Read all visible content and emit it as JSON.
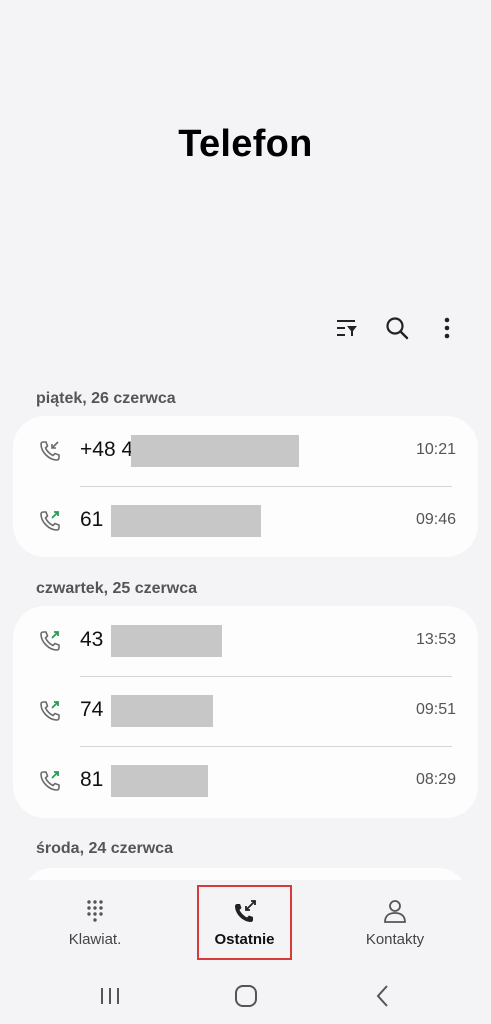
{
  "header": {
    "title": "Telefon"
  },
  "toolbar": {
    "filter_icon": "filter-icon",
    "search_icon": "search-icon",
    "more_icon": "more-vertical-icon"
  },
  "groups": [
    {
      "date": "piątek, 26 czerwca",
      "calls": [
        {
          "number": "+48 4",
          "time": "10:21",
          "type": "incoming"
        },
        {
          "number": "61",
          "time": "09:46",
          "type": "outgoing"
        }
      ]
    },
    {
      "date": "czwartek, 25 czerwca",
      "calls": [
        {
          "number": "43",
          "time": "13:53",
          "type": "outgoing"
        },
        {
          "number": "74",
          "time": "09:51",
          "type": "outgoing"
        },
        {
          "number": "81",
          "time": "08:29",
          "type": "outgoing"
        }
      ]
    },
    {
      "date": "środa, 24 czerwca",
      "calls": []
    }
  ],
  "nav": {
    "keypad": "Klawiat.",
    "recents": "Ostatnie",
    "contacts": "Kontakty"
  },
  "colors": {
    "accent": "#2e9a55",
    "incoming": "#6a6a6a",
    "highlight": "#d83a3a"
  }
}
